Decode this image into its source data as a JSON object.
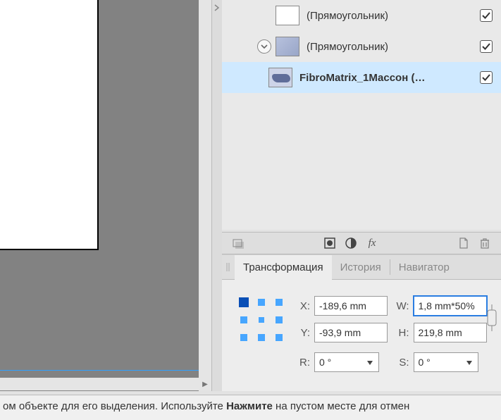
{
  "layers": {
    "items": [
      {
        "name": "(Прямоугольник)",
        "selected": false,
        "bold": false
      },
      {
        "name": "(Прямоугольник)",
        "selected": false,
        "bold": false
      },
      {
        "name": "FibroMatrix_1Массон (…",
        "selected": true,
        "bold": true
      }
    ]
  },
  "tabs": {
    "transform": "Трансформация",
    "history": "История",
    "navigator": "Навигатор"
  },
  "transform": {
    "x_label": "X:",
    "y_label": "Y:",
    "w_label": "W:",
    "h_label": "H:",
    "r_label": "R:",
    "s_label": "S:",
    "x": "-189,6 mm",
    "y": "-93,9 mm",
    "w": "1,8 mm*50%",
    "h": "219,8 mm",
    "r": "0 °",
    "s": "0 °"
  },
  "status": {
    "part1": "ом объекте для его выделения. Используйте ",
    "bold": "Нажмите",
    "part2": " на пустом месте для отмен"
  }
}
